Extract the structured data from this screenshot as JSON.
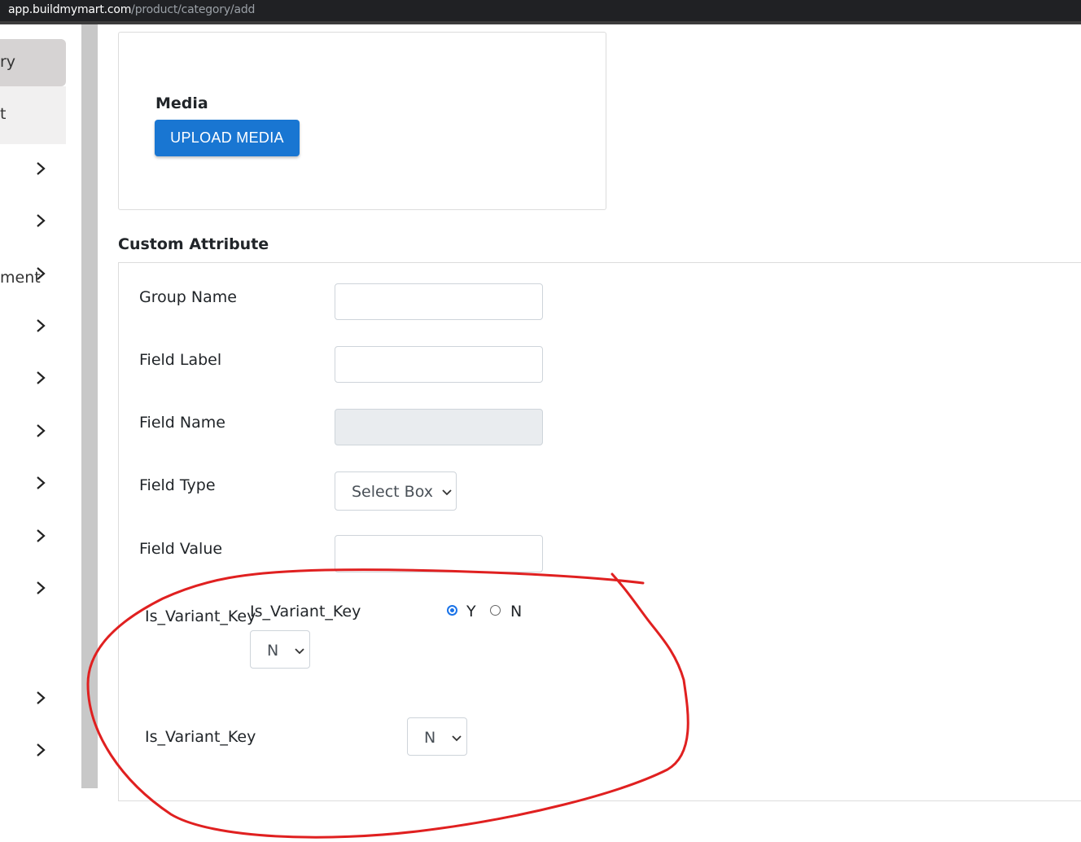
{
  "browser": {
    "url_host": "app.buildmymart.com",
    "url_path": "/product/category/add"
  },
  "sidebar": {
    "items": [
      {
        "label": "ry"
      },
      {
        "label": "t"
      },
      {
        "label": "ment"
      }
    ]
  },
  "media": {
    "label": "Media",
    "upload_button": "UPLOAD MEDIA"
  },
  "custom_attribute": {
    "title": "Custom Attribute",
    "group_name_label": "Group Name",
    "group_name_value": "",
    "field_label_label": "Field Label",
    "field_label_value": "",
    "field_name_label": "Field Name",
    "field_name_value": "",
    "field_type_label": "Field Type",
    "field_type_value": "Select Box",
    "field_value_label": "Field Value",
    "field_value_value": "",
    "variant_key_outer_label": "Is_Variant_Key",
    "variant_key_inner_label": "Is_Variant_Key",
    "radio_y_label": "Y",
    "radio_n_label": "N",
    "radio_selected": "Y",
    "variant_select_value": "N",
    "variant_key_label_2": "Is_Variant_Key",
    "variant_select_value_2": "N"
  },
  "colors": {
    "primary": "#1976d2",
    "annotation": "#e02020"
  }
}
